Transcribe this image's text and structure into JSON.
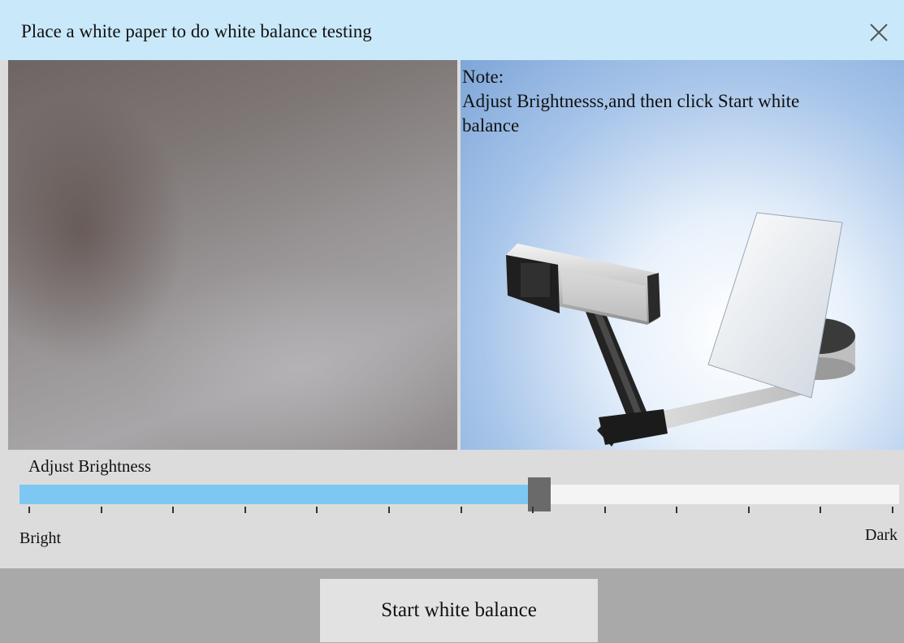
{
  "dialog": {
    "title": "Place a white paper to do white balance testing",
    "close_icon": "close-icon"
  },
  "illustration": {
    "note_title": "Note:",
    "note_lines": [
      "Adjust Brightnesss,and then click Start white",
      "balance"
    ]
  },
  "brightness": {
    "label": "Adjust Brightness",
    "min_label": "Bright",
    "max_label": "Dark",
    "value_fraction": 0.585,
    "tick_count": 13
  },
  "footer": {
    "start_label": "Start white balance"
  },
  "colors": {
    "title_bar": "#c9e9fb",
    "slider_fill": "#7dc8f2",
    "slider_thumb": "#6a6a6a",
    "footer": "#a9a9a9"
  }
}
